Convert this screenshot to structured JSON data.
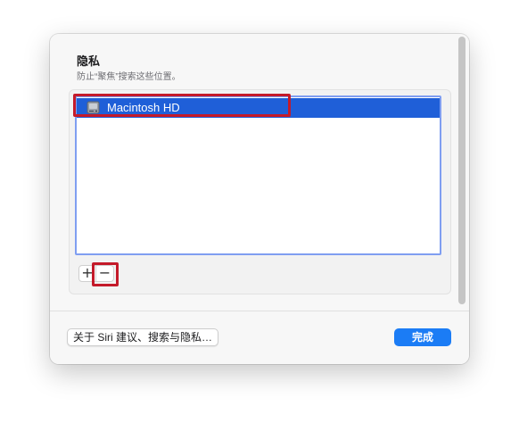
{
  "privacy": {
    "title": "隐私",
    "description": "防止“聚焦”搜索这些位置。",
    "locations": [
      {
        "label": "Macintosh HD",
        "icon": "hard-disk-icon",
        "selected": true
      }
    ],
    "add_label": "+",
    "remove_label": "−"
  },
  "footer": {
    "about_label": "关于 Siri 建议、搜索与隐私…",
    "done_label": "完成"
  },
  "colors": {
    "selection": "#1f5fd8",
    "highlight_annotation": "#c41a2a",
    "primary_button": "#1b7cf5",
    "list_focus_ring": "#7f9ef1"
  }
}
